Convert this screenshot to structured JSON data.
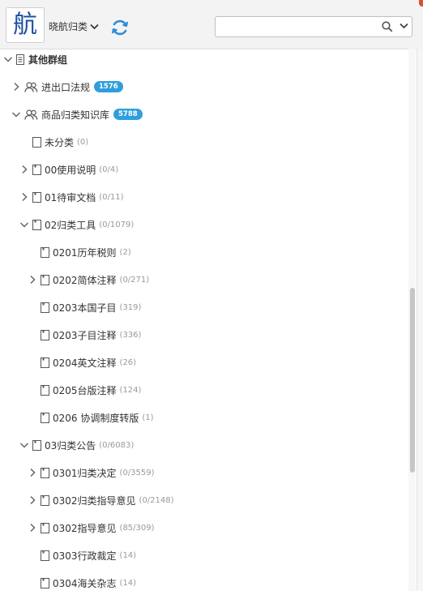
{
  "header": {
    "logo_char": "航",
    "user_menu_label": "晓航归类",
    "search": {
      "value": "",
      "placeholder": ""
    }
  },
  "tree": [
    {
      "label": "其他群组",
      "count": "",
      "badge": "",
      "level": 0,
      "expand": "down",
      "icon": "notebook",
      "bold": true
    },
    {
      "label": "进出口法规",
      "count": "",
      "badge": "1576",
      "level": 1,
      "expand": "right",
      "icon": "group",
      "bold": false
    },
    {
      "label": "商品归类知识库",
      "count": "",
      "badge": "5788",
      "level": 1,
      "expand": "down",
      "icon": "group",
      "bold": false
    },
    {
      "label": "未分类",
      "count": "(0)",
      "badge": "",
      "level": 2,
      "expand": "none",
      "icon": "doc",
      "bold": false
    },
    {
      "label": "00使用说明",
      "count": "(0/4)",
      "badge": "",
      "level": 2,
      "expand": "right",
      "icon": "note",
      "bold": false
    },
    {
      "label": "01待审文档",
      "count": "(0/11)",
      "badge": "",
      "level": 2,
      "expand": "right",
      "icon": "note",
      "bold": false
    },
    {
      "label": "02归类工具",
      "count": "(0/1079)",
      "badge": "",
      "level": 2,
      "expand": "down",
      "icon": "note",
      "bold": false
    },
    {
      "label": "0201历年税则",
      "count": "(2)",
      "badge": "",
      "level": 3,
      "expand": "none",
      "icon": "note",
      "bold": false
    },
    {
      "label": "0202简体注释",
      "count": "(0/271)",
      "badge": "",
      "level": 3,
      "expand": "right",
      "icon": "note",
      "bold": false
    },
    {
      "label": "0203本国子目",
      "count": "(319)",
      "badge": "",
      "level": 3,
      "expand": "none",
      "icon": "note",
      "bold": false
    },
    {
      "label": "0203子目注释",
      "count": "(336)",
      "badge": "",
      "level": 3,
      "expand": "none",
      "icon": "note",
      "bold": false
    },
    {
      "label": "0204英文注释",
      "count": "(26)",
      "badge": "",
      "level": 3,
      "expand": "none",
      "icon": "note",
      "bold": false
    },
    {
      "label": "0205台版注释",
      "count": "(124)",
      "badge": "",
      "level": 3,
      "expand": "none",
      "icon": "note",
      "bold": false
    },
    {
      "label": "0206 协调制度转版",
      "count": "(1)",
      "badge": "",
      "level": 3,
      "expand": "none",
      "icon": "note",
      "bold": false
    },
    {
      "label": "03归类公告",
      "count": "(0/6083)",
      "badge": "",
      "level": 2,
      "expand": "down",
      "icon": "note",
      "bold": false
    },
    {
      "label": "0301归类决定",
      "count": "(0/3559)",
      "badge": "",
      "level": 3,
      "expand": "right",
      "icon": "note",
      "bold": false
    },
    {
      "label": "0302归类指导意见",
      "count": "(0/2148)",
      "badge": "",
      "level": 3,
      "expand": "right",
      "icon": "note",
      "bold": false
    },
    {
      "label": "0302指导意见",
      "count": "(85/309)",
      "badge": "",
      "level": 3,
      "expand": "right",
      "icon": "note",
      "bold": false
    },
    {
      "label": "0303行政裁定",
      "count": "(14)",
      "badge": "",
      "level": 3,
      "expand": "none",
      "icon": "note",
      "bold": false
    },
    {
      "label": "0304海关杂志",
      "count": "(14)",
      "badge": "",
      "level": 3,
      "expand": "none",
      "icon": "note",
      "bold": false
    }
  ]
}
